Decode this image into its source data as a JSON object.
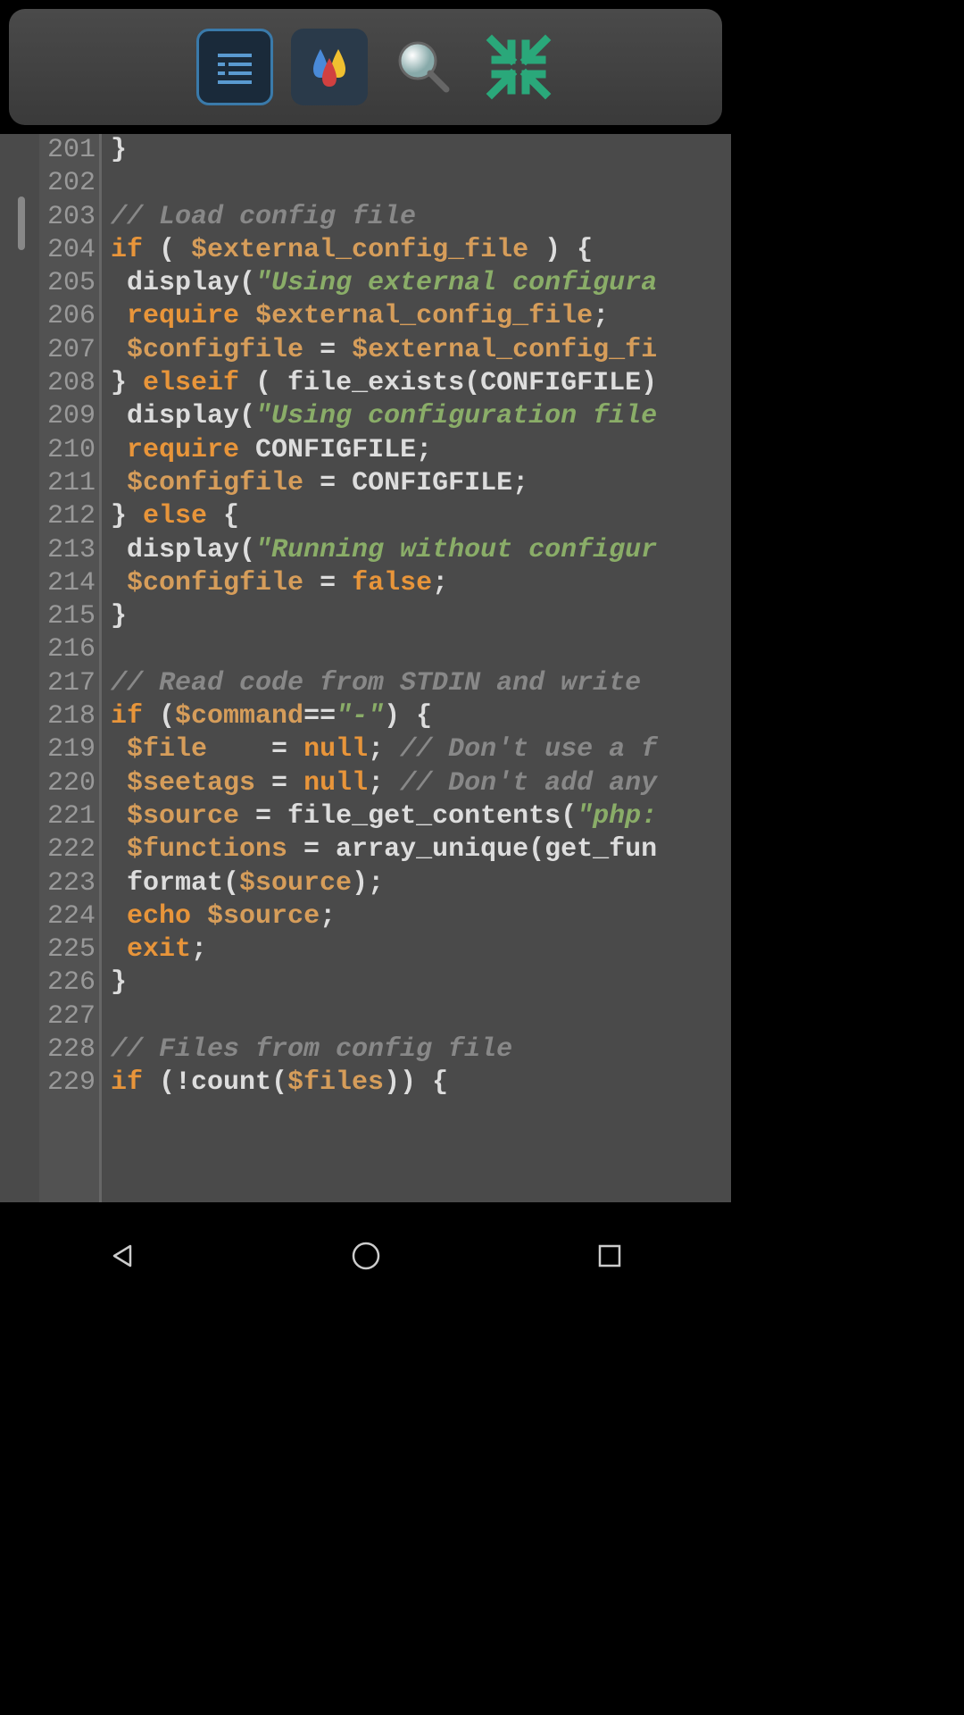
{
  "toolbar": {
    "items": [
      "code-view",
      "color-picker",
      "search",
      "collapse"
    ]
  },
  "line_numbers": [
    "201",
    "202",
    "203",
    "204",
    "205",
    "206",
    "207",
    "208",
    "209",
    "210",
    "211",
    "212",
    "213",
    "214",
    "215",
    "216",
    "217",
    "218",
    "219",
    "220",
    "221",
    "222",
    "223",
    "224",
    "225",
    "226",
    "227",
    "228",
    "229"
  ],
  "code_lines": [
    [
      {
        "t": "}",
        "c": ""
      }
    ],
    [],
    [
      {
        "t": "// Load config file",
        "c": "cmt"
      }
    ],
    [
      {
        "t": "if",
        "c": "kw"
      },
      {
        "t": " ( ",
        "c": ""
      },
      {
        "t": "$external_config_file",
        "c": "var"
      },
      {
        "t": " ) {",
        "c": ""
      }
    ],
    [
      {
        "t": " display(",
        "c": ""
      },
      {
        "t": "\"Using external configura",
        "c": "str"
      }
    ],
    [
      {
        "t": " ",
        "c": ""
      },
      {
        "t": "require",
        "c": "kw"
      },
      {
        "t": " ",
        "c": ""
      },
      {
        "t": "$external_config_file",
        "c": "var"
      },
      {
        "t": ";",
        "c": ""
      }
    ],
    [
      {
        "t": " ",
        "c": ""
      },
      {
        "t": "$configfile",
        "c": "var"
      },
      {
        "t": " = ",
        "c": ""
      },
      {
        "t": "$external_config_fi",
        "c": "var"
      }
    ],
    [
      {
        "t": "} ",
        "c": ""
      },
      {
        "t": "elseif",
        "c": "kw"
      },
      {
        "t": " ( file_exists(CONFIGFILE)",
        "c": ""
      }
    ],
    [
      {
        "t": " display(",
        "c": ""
      },
      {
        "t": "\"Using configuration file",
        "c": "str"
      }
    ],
    [
      {
        "t": " ",
        "c": ""
      },
      {
        "t": "require",
        "c": "kw"
      },
      {
        "t": " CONFIGFILE;",
        "c": ""
      }
    ],
    [
      {
        "t": " ",
        "c": ""
      },
      {
        "t": "$configfile",
        "c": "var"
      },
      {
        "t": " = CONFIGFILE;",
        "c": ""
      }
    ],
    [
      {
        "t": "} ",
        "c": ""
      },
      {
        "t": "else",
        "c": "kw"
      },
      {
        "t": " {",
        "c": ""
      }
    ],
    [
      {
        "t": " display(",
        "c": ""
      },
      {
        "t": "\"Running without configur",
        "c": "str"
      }
    ],
    [
      {
        "t": " ",
        "c": ""
      },
      {
        "t": "$configfile",
        "c": "var"
      },
      {
        "t": " = ",
        "c": ""
      },
      {
        "t": "false",
        "c": "kw"
      },
      {
        "t": ";",
        "c": ""
      }
    ],
    [
      {
        "t": "}",
        "c": ""
      }
    ],
    [],
    [
      {
        "t": "// Read code from STDIN and write",
        "c": "cmt"
      }
    ],
    [
      {
        "t": "if",
        "c": "kw"
      },
      {
        "t": " (",
        "c": ""
      },
      {
        "t": "$command",
        "c": "var"
      },
      {
        "t": "==",
        "c": ""
      },
      {
        "t": "\"-\"",
        "c": "str"
      },
      {
        "t": ") {",
        "c": ""
      }
    ],
    [
      {
        "t": " ",
        "c": ""
      },
      {
        "t": "$file",
        "c": "var"
      },
      {
        "t": "    = ",
        "c": ""
      },
      {
        "t": "null",
        "c": "kw"
      },
      {
        "t": "; ",
        "c": ""
      },
      {
        "t": "// Don't use a f",
        "c": "cmt"
      }
    ],
    [
      {
        "t": " ",
        "c": ""
      },
      {
        "t": "$seetags",
        "c": "var"
      },
      {
        "t": " = ",
        "c": ""
      },
      {
        "t": "null",
        "c": "kw"
      },
      {
        "t": "; ",
        "c": ""
      },
      {
        "t": "// Don't add any",
        "c": "cmt"
      }
    ],
    [
      {
        "t": " ",
        "c": ""
      },
      {
        "t": "$source",
        "c": "var"
      },
      {
        "t": " = file_get_contents(",
        "c": ""
      },
      {
        "t": "\"php:",
        "c": "str"
      }
    ],
    [
      {
        "t": " ",
        "c": ""
      },
      {
        "t": "$functions",
        "c": "var"
      },
      {
        "t": " = array_unique(get_fun",
        "c": ""
      }
    ],
    [
      {
        "t": " format(",
        "c": ""
      },
      {
        "t": "$source",
        "c": "var"
      },
      {
        "t": ");",
        "c": ""
      }
    ],
    [
      {
        "t": " ",
        "c": ""
      },
      {
        "t": "echo",
        "c": "kw"
      },
      {
        "t": " ",
        "c": ""
      },
      {
        "t": "$source",
        "c": "var"
      },
      {
        "t": ";",
        "c": ""
      }
    ],
    [
      {
        "t": " ",
        "c": ""
      },
      {
        "t": "exit",
        "c": "kw"
      },
      {
        "t": ";",
        "c": ""
      }
    ],
    [
      {
        "t": "}",
        "c": ""
      }
    ],
    [],
    [
      {
        "t": "// Files from config file",
        "c": "cmt"
      }
    ],
    [
      {
        "t": "if",
        "c": "kw"
      },
      {
        "t": " (!count(",
        "c": ""
      },
      {
        "t": "$files",
        "c": "var"
      },
      {
        "t": ")) {",
        "c": ""
      }
    ]
  ],
  "navbar": {
    "buttons": [
      "back",
      "home",
      "recent"
    ]
  }
}
